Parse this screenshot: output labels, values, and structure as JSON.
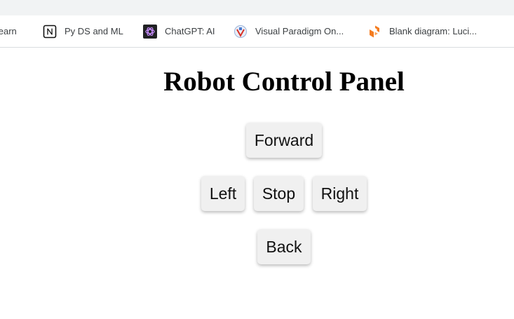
{
  "bookmarks_bar": {
    "items": [
      {
        "label": "g learn",
        "icon": "none"
      },
      {
        "label": "Py DS and ML",
        "icon": "notion-icon"
      },
      {
        "label": "ChatGPT: AI",
        "icon": "chatgpt-icon"
      },
      {
        "label": "Visual Paradigm On...",
        "icon": "visual-paradigm-icon"
      },
      {
        "label": "Blank diagram: Luci...",
        "icon": "lucidchart-icon"
      }
    ]
  },
  "page": {
    "title": "Robot Control Panel"
  },
  "controls": {
    "forward": "Forward",
    "left": "Left",
    "stop": "Stop",
    "right": "Right",
    "back": "Back"
  }
}
